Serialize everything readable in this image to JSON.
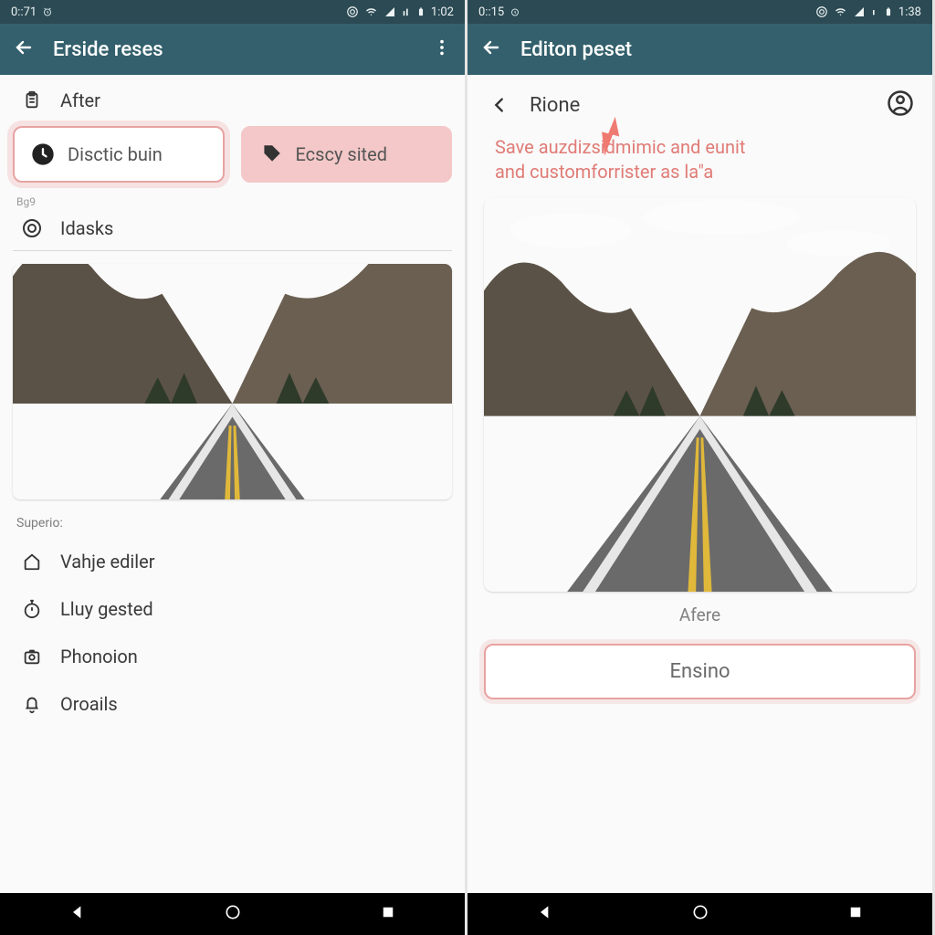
{
  "left": {
    "statusbar": {
      "time_left": "0::71",
      "time_right": "1:02"
    },
    "appbar": {
      "title": "Erside reses"
    },
    "header_row": {
      "label": "After"
    },
    "buttons": {
      "primary": "Disctic buin",
      "secondary": "Ecscy sited"
    },
    "small_label": "Bg9",
    "idasks": "Idasks",
    "section_label": "Superio:",
    "list": [
      "Vahje ediler",
      "Lluy gested",
      "Phonoion",
      "Oroails"
    ]
  },
  "right": {
    "statusbar": {
      "time_left": "0::15",
      "time_right": "1:38"
    },
    "appbar": {
      "title": "Editon peset"
    },
    "sub": {
      "title": "Rione"
    },
    "helper_line1": "Save auzdizsidmimic and eunit",
    "helper_line2": "and customforrister as la\"a",
    "caption": "Afere",
    "cta": "Ensino"
  }
}
